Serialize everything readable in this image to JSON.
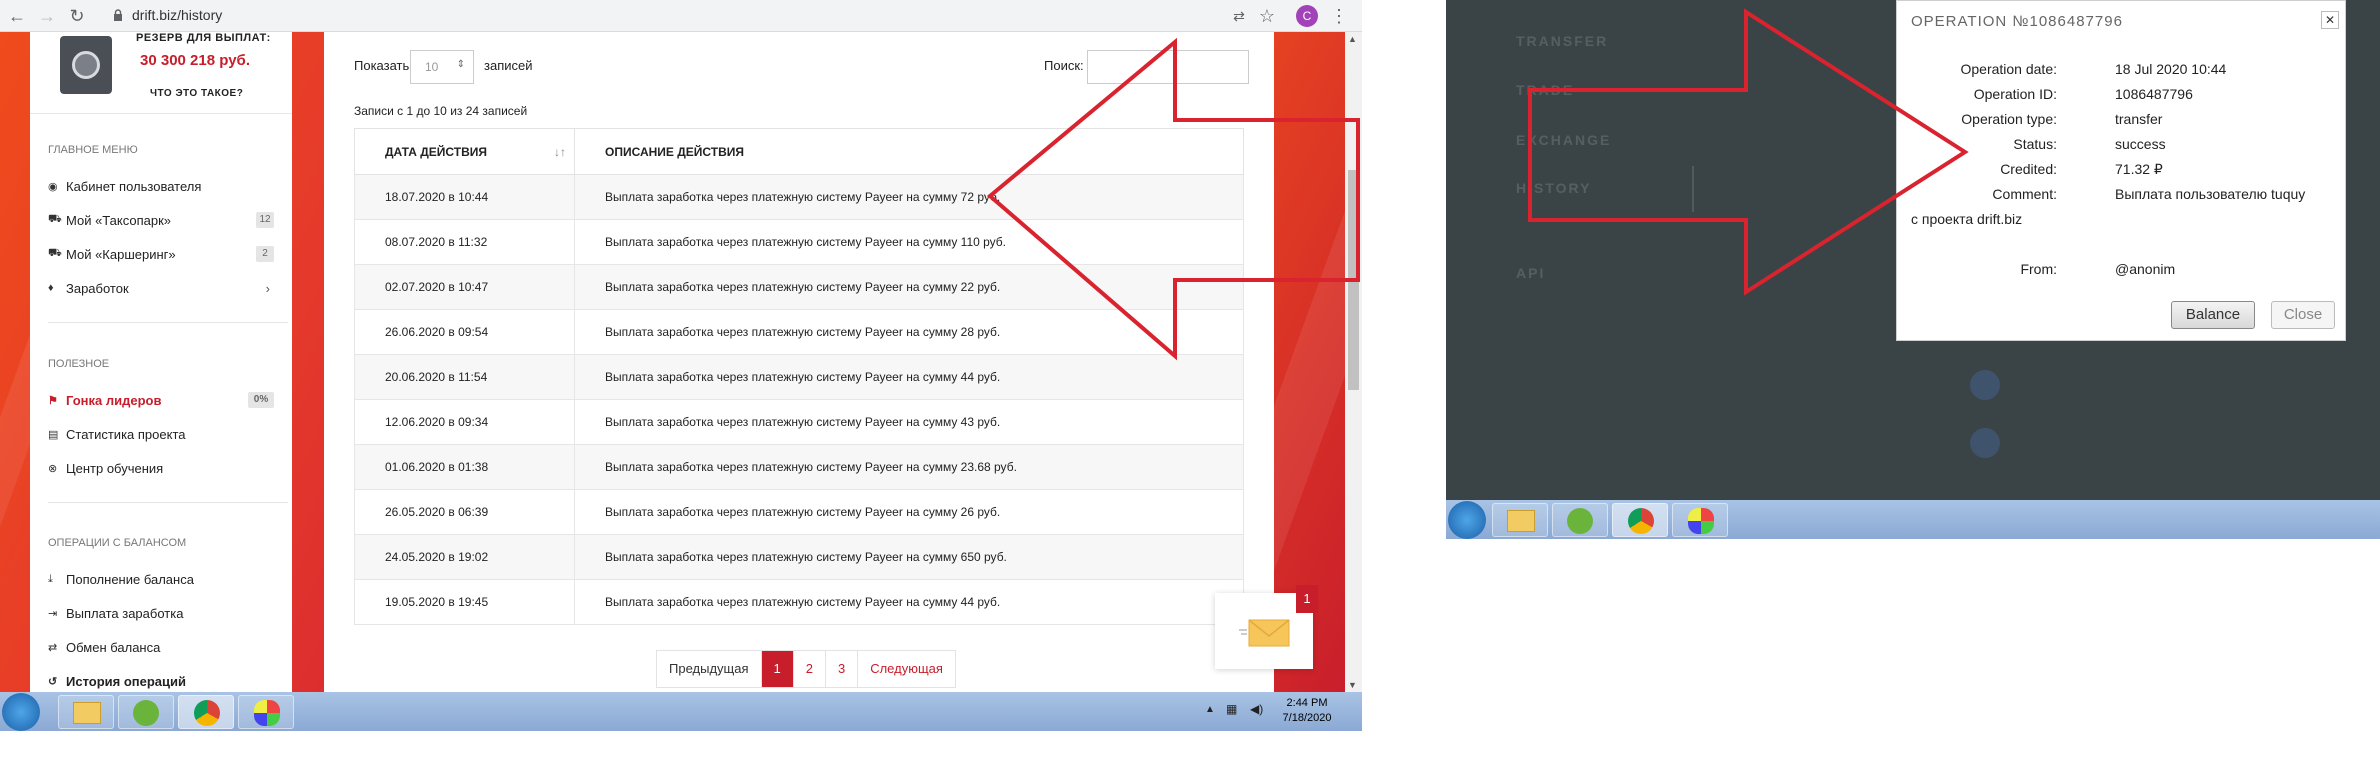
{
  "browser": {
    "url": "drift.biz/history"
  },
  "sidebar": {
    "reserve_label": "РЕЗЕРВ ДЛЯ ВЫПЛАТ:",
    "reserve_amount": "30 300 218 руб.",
    "what_is_it": "ЧТО ЭТО ТАКОЕ?",
    "main_menu_title": "ГЛАВНОЕ МЕНЮ",
    "main_menu": [
      {
        "label": "Кабинет пользователя",
        "icon": "dashboard-icon"
      },
      {
        "label": "Мой «Таксопарк»",
        "icon": "car-icon",
        "badge": "12"
      },
      {
        "label": "Мой «Каршеринг»",
        "icon": "car-icon",
        "badge": "2"
      },
      {
        "label": "Заработок",
        "icon": "money-bag-icon",
        "arrow": "›"
      }
    ],
    "useful_title": "ПОЛЕЗНОЕ",
    "useful": [
      {
        "label": "Гонка лидеров",
        "icon": "flag-icon",
        "badge": "0%"
      },
      {
        "label": "Статистика проекта",
        "icon": "chart-icon"
      },
      {
        "label": "Центр обучения",
        "icon": "lifebuoy-icon"
      }
    ],
    "balance_ops_title": "ОПЕРАЦИИ С БАЛАНСОМ",
    "balance_ops": [
      {
        "label": "Пополнение баланса",
        "icon": "deposit-icon"
      },
      {
        "label": "Выплата заработка",
        "icon": "withdraw-icon"
      },
      {
        "label": "Обмен баланса",
        "icon": "exchange-icon"
      },
      {
        "label": "История операций",
        "icon": "history-icon"
      }
    ]
  },
  "main": {
    "show_label": "Показать",
    "show_value": "10",
    "records_label": "записей",
    "search_label": "Поиск:",
    "summary": "Записи с 1 до 10 из 24 записей",
    "columns": [
      "ДАТА ДЕЙСТВИЯ",
      "ОПИСАНИЕ ДЕЙСТВИЯ"
    ],
    "rows": [
      [
        "18.07.2020 в 10:44",
        "Выплата заработка через платежную систему Payeer на сумму 72 руб."
      ],
      [
        "08.07.2020 в 11:32",
        "Выплата заработка через платежную систему Payeer на сумму 110 руб."
      ],
      [
        "02.07.2020 в 10:47",
        "Выплата заработка через платежную систему Payeer на сумму 22 руб."
      ],
      [
        "26.06.2020 в 09:54",
        "Выплата заработка через платежную систему Payeer на сумму 28 руб."
      ],
      [
        "20.06.2020 в 11:54",
        "Выплата заработка через платежную систему Payeer на сумму 44 руб."
      ],
      [
        "12.06.2020 в 09:34",
        "Выплата заработка через платежную систему Payeer на сумму 43 руб."
      ],
      [
        "01.06.2020 в 01:38",
        "Выплата заработка через платежную систему Payeer на сумму 23.68 руб."
      ],
      [
        "26.05.2020 в 06:39",
        "Выплата заработка через платежную систему Payeer на сумму 26 руб."
      ],
      [
        "24.05.2020 в 19:02",
        "Выплата заработка через платежную систему Payeer на сумму 650 руб."
      ],
      [
        "19.05.2020 в 19:45",
        "Выплата заработка через платежную систему Payeer на сумму 44 руб."
      ]
    ],
    "pager": {
      "prev": "Предыдущая",
      "pages": [
        "1",
        "2",
        "3"
      ],
      "current": "1",
      "next": "Следующая"
    },
    "mail_count": "1"
  },
  "taskbar": {
    "time": "2:44 PM",
    "date": "7/18/2020"
  },
  "dialog": {
    "title": "OPERATION №1086487796",
    "fields": [
      {
        "label": "Operation date:",
        "value": "18 Jul 2020 10:44"
      },
      {
        "label": "Operation ID:",
        "value": "1086487796"
      },
      {
        "label": "Operation type:",
        "value": "transfer"
      },
      {
        "label": "Status:",
        "value": "success"
      },
      {
        "label": "Credited:",
        "value": "71.32 ₽"
      },
      {
        "label": "Comment:",
        "value": "Выплата пользователю tuquy"
      }
    ],
    "comment_cont": "с проекта drift.biz",
    "from_label": "From:",
    "from_value": "@anonim",
    "balance_btn": "Balance",
    "close_btn": "Close"
  },
  "background_menu": [
    "TRANSFER",
    "TRADE",
    "EXCHANGE",
    "HISTORY",
    "API"
  ],
  "colors": {
    "accent_red": "#c81d2b",
    "arrow_red": "#d9232e",
    "dialog_bg": "#ffffff",
    "dark_bg": "#3a4446"
  }
}
